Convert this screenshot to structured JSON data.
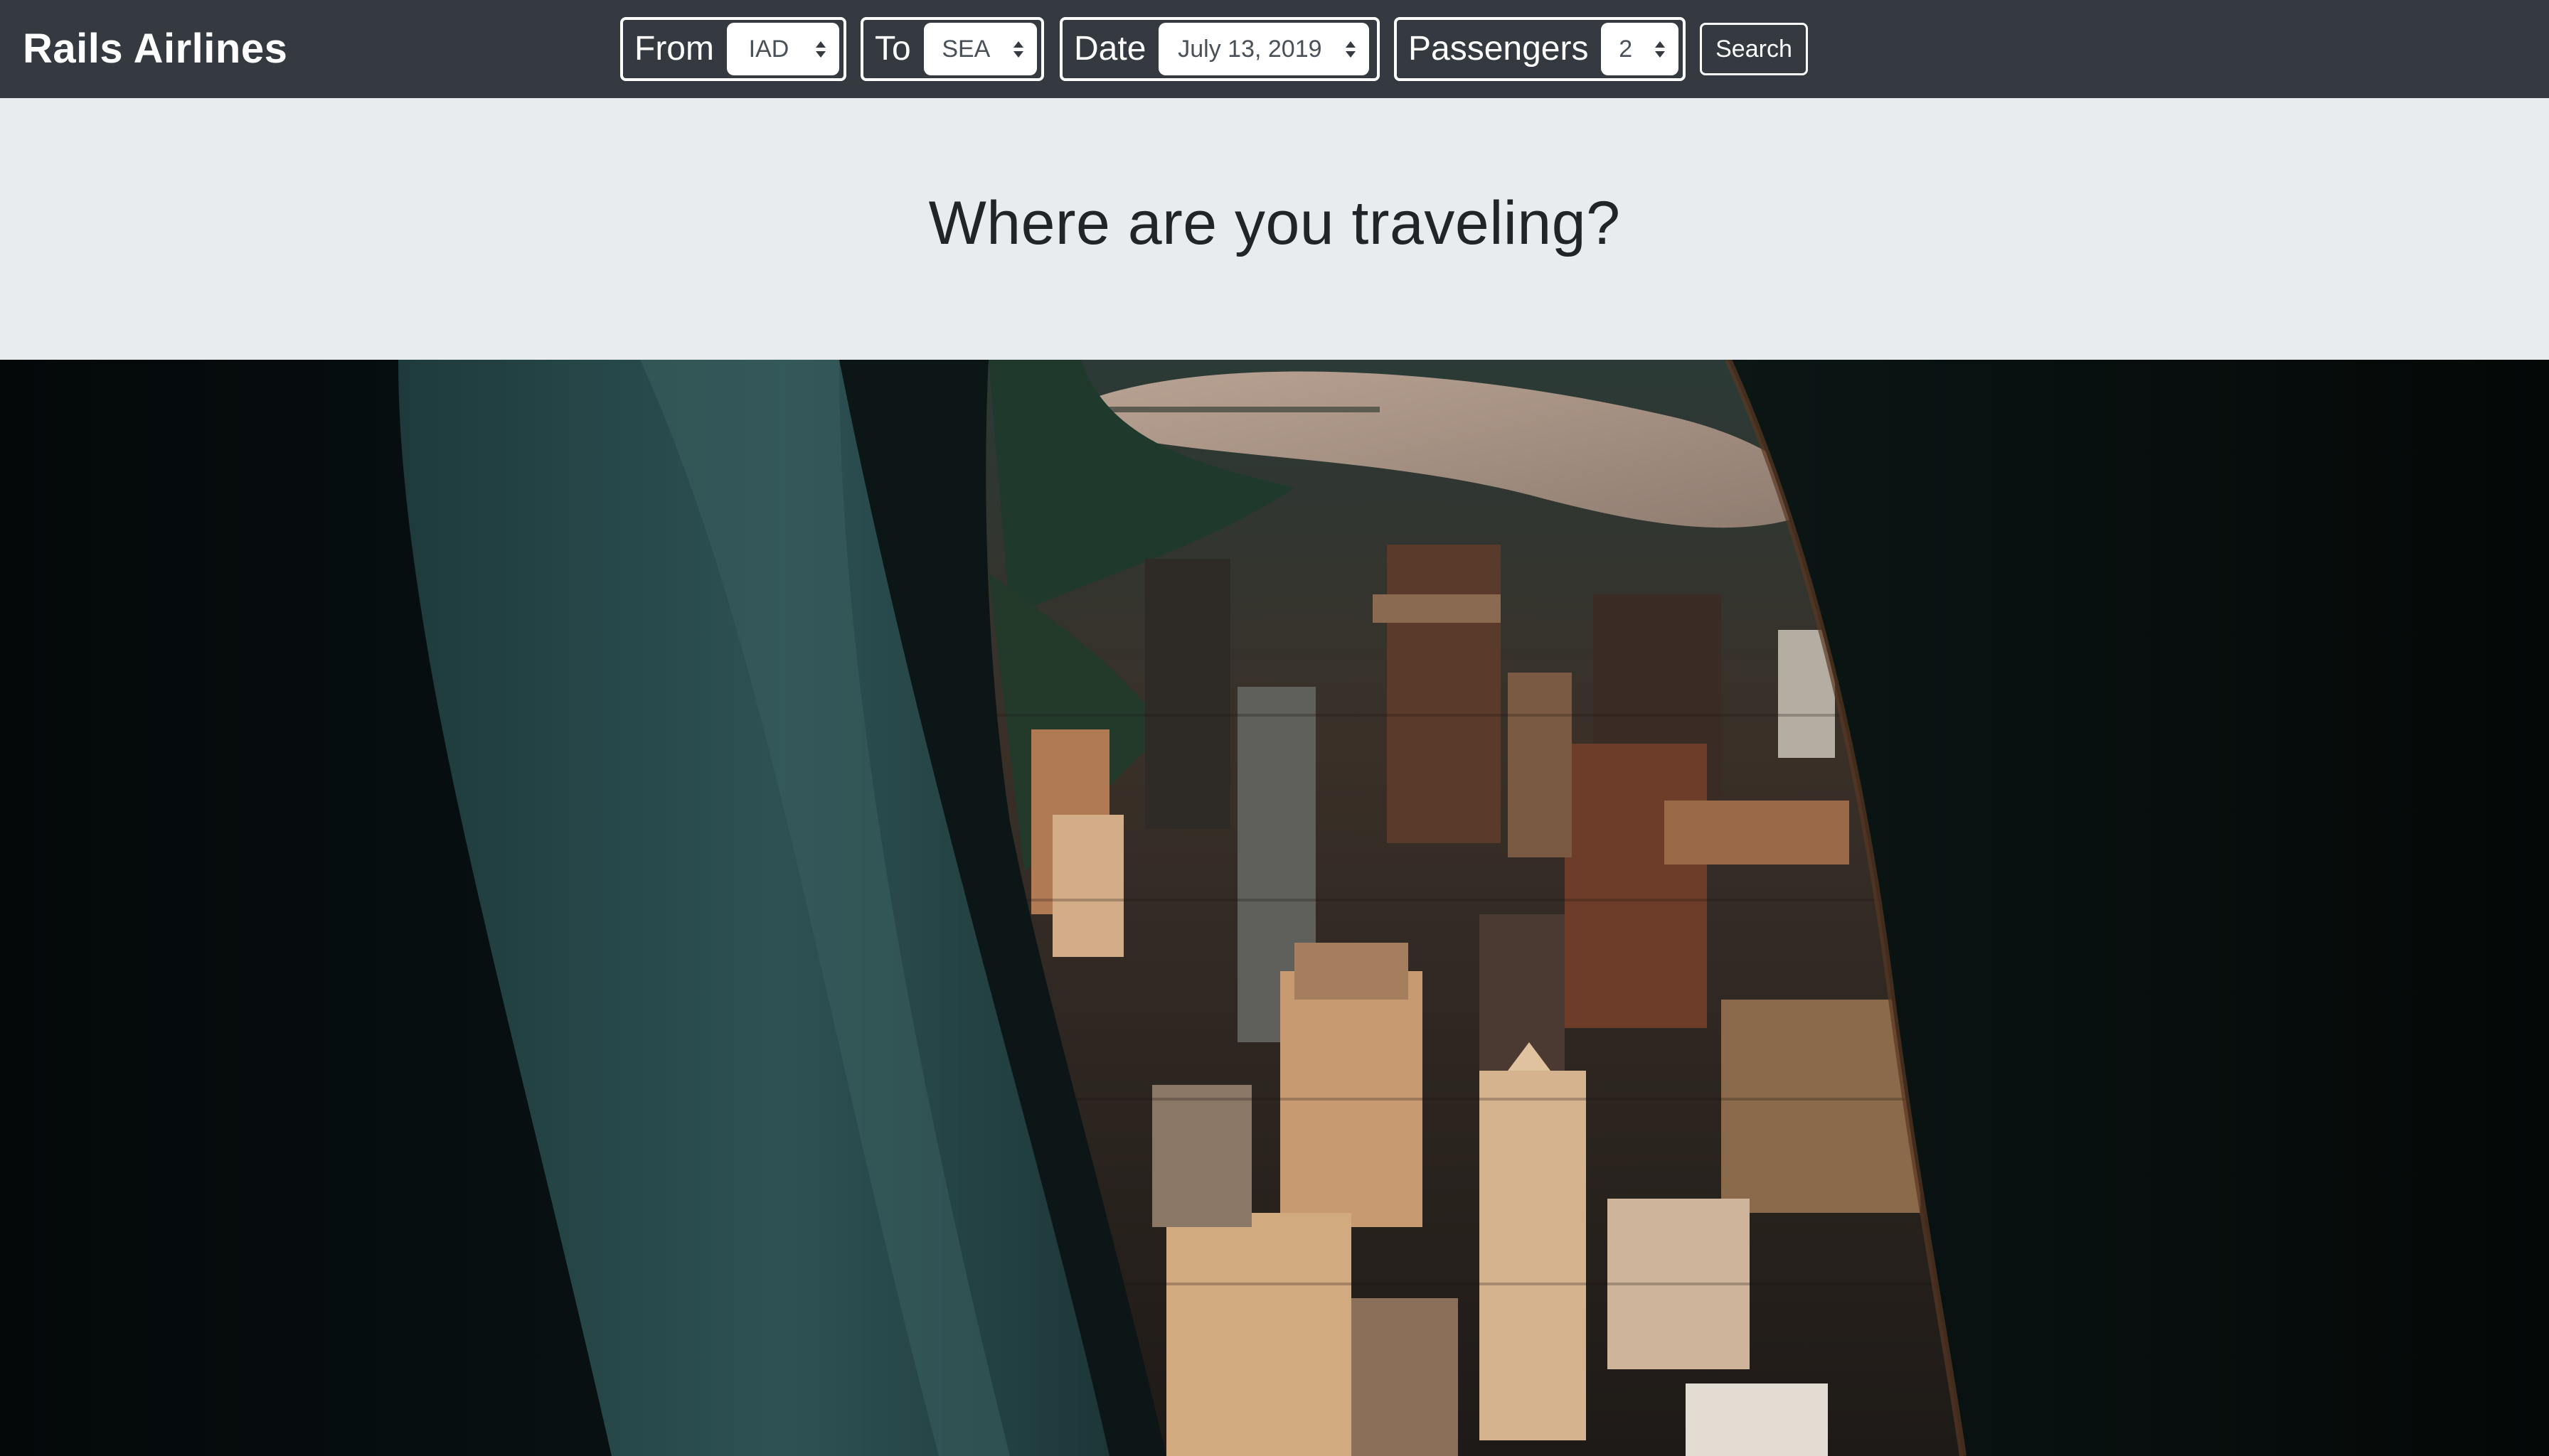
{
  "navbar": {
    "brand": "Rails Airlines",
    "from": {
      "label": "From",
      "value": "IAD"
    },
    "to": {
      "label": "To",
      "value": "SEA"
    },
    "date": {
      "label": "Date",
      "value": "July 13, 2019"
    },
    "passengers": {
      "label": "Passengers",
      "value": "2"
    },
    "search_label": "Search"
  },
  "hero": {
    "title": "Where are you traveling?"
  },
  "photo": {
    "subject": "airplane-window-city-view-icon"
  },
  "colors": {
    "navbar_bg": "#343a40",
    "jumbotron_bg": "#e9ecef",
    "text_dark": "#212529",
    "white": "#ffffff"
  }
}
